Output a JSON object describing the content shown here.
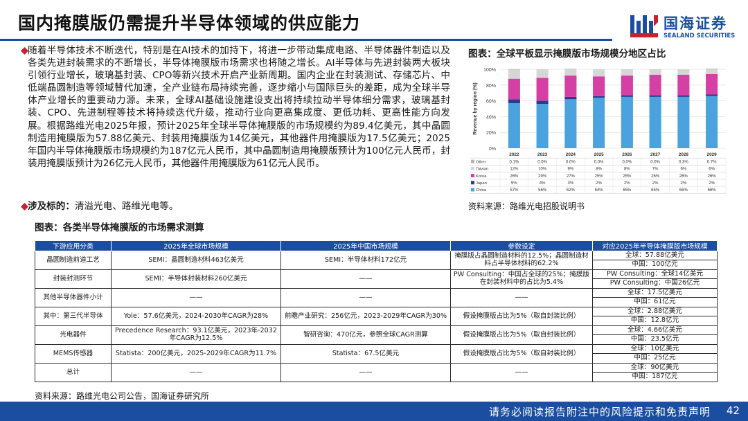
{
  "header": {
    "title": "国内掩膜版仍需提升半导体领域的供应能力",
    "brand_cn": "国海证券",
    "brand_en": "SEALAND SECURITIES"
  },
  "body": {
    "para1": "随着半导体技术不断迭代，特别是在AI技术的加持下，将进一步带动集成电路、半导体器件制造以及各类先进封装需求的不断增长，半导体掩膜版市场需求也将随之增长。AI半导体与先进封装两大板块引领行业增长，玻璃基封装、CPO等新兴技术开启产业新周期。国内企业在封装测试、存储芯片、中低端晶圆制造等领域替代加速，全产业链布局持续完善，逐步缩小与国际巨头的差距，成为全球半导体产业增长的重要动力源。未来，全球AI基础设施建设支出将持续拉动半导体细分需求，玻璃基封装、CPO、先进制程等技术将持续迭代升级，推动行业向更高集成度、更低功耗、更高性能方向发展。根据路维光电2025年报，预计2025年全球半导体掩膜版的市场规模约为89.4亿美元，其中晶圆制造用掩膜版为57.88亿美元、封装用掩膜版为14亿美元，其他器件用掩膜版为17.5亿美元；2025年国内半导体掩膜版市场规模约为187亿元人民币，其中晶圆制造用掩膜版预计为100亿元人民币，封装用掩膜版预计为26亿元人民币，其他器件用掩膜版为61亿元人民币。",
    "para2_label": "涉及标的：",
    "para2_text": "清溢光电、路维光电等。"
  },
  "chart": {
    "title": "图表：全球平板显示掩膜版市场规模分地区占比",
    "source": "资料来源：路维光电招股说明书"
  },
  "chart_data": {
    "type": "bar",
    "stacked": true,
    "categories": [
      "2022",
      "2023",
      "2024",
      "2025",
      "2026",
      "2027",
      "2028",
      "2029"
    ],
    "ylabel": "Revenue by region (%)",
    "yticks": [
      "0%",
      "20%",
      "40%",
      "60%",
      "80%",
      "100%"
    ],
    "ylim": [
      0,
      100
    ],
    "grid": true,
    "series": [
      {
        "name": "Other",
        "color": "#b3b3b3",
        "values": [
          0.1,
          0.0,
          0.0,
          0.0,
          0.0,
          0.0,
          0.3,
          0.7
        ],
        "labels": [
          "0.1%",
          "0.0%",
          "0.0%",
          "0.0%",
          "0.0%",
          "0.0%",
          "0.3%",
          "0.7%"
        ]
      },
      {
        "name": "Taiwan",
        "color": "#d6d6d6",
        "values": [
          12,
          10,
          9,
          8,
          8,
          7,
          6,
          6
        ],
        "labels": [
          "12%",
          "10%",
          "9%",
          "8%",
          "8%",
          "7%",
          "6%",
          "6%"
        ]
      },
      {
        "name": "Korea",
        "color": "#d63fa3",
        "values": [
          26,
          29,
          27,
          25,
          25,
          26,
          26,
          26
        ],
        "labels": [
          "26%",
          "29%",
          "27%",
          "25%",
          "25%",
          "26%",
          "26%",
          "26%"
        ]
      },
      {
        "name": "Japan",
        "color": "#2a3c8f",
        "values": [
          5,
          4,
          3,
          2,
          2,
          2,
          2,
          2
        ],
        "labels": [
          "5%",
          "4%",
          "3%",
          "2%",
          "2%",
          "2%",
          "2%",
          "2%"
        ]
      },
      {
        "name": "China",
        "color": "#4aa3df",
        "values": [
          57,
          56,
          62,
          64,
          65,
          65,
          65,
          66
        ],
        "labels": [
          "57%",
          "56%",
          "62%",
          "64%",
          "65%",
          "65%",
          "65%",
          "66%"
        ]
      }
    ]
  },
  "table": {
    "title": "图表：各类半导体掩膜版的市场需求测算",
    "headers": [
      "下游应用分类",
      "2025年全球市场规模",
      "2025年中国市场规模",
      "参数设定",
      "对应2025年半导体掩膜版市场规模"
    ],
    "rows": [
      {
        "cat": "晶圆制造前道工艺",
        "global": "SEMI：晶圆制造材料463亿美元",
        "china": "SEMI：半导体材料172亿元",
        "param": "掩膜版占晶圆制造材料的12.5%；晶圆制造材料占半导体材料的62.2%",
        "result": [
          "全球：57.88亿美元",
          "中国：100亿元"
        ]
      },
      {
        "cat": "封装封测环节",
        "global": "SEMI：半导体封装材料260亿美元",
        "china": "——",
        "param": "PW Consulting：中国占全球的25%；掩膜版在封装材料中的占比为5.4%",
        "result": [
          "PW Consulting：全球14亿美元",
          "PW Consulting：中国26亿元"
        ]
      },
      {
        "cat": "其他半导体器件小计",
        "global": "——",
        "china": "——",
        "param": "——",
        "result": [
          "全球：17.5亿美元",
          "中国：61亿元"
        ]
      },
      {
        "cat": "其中：第三代半导体",
        "global": "Yole：57.6亿美元，2024-2030年CAGR为28%",
        "china": "前瞻产业研究：256亿元，2023-2029年CAGR为30%",
        "param": "假设掩膜版占比为5%（取自封装比例）",
        "result": [
          "全球：2.88亿美元",
          "中国：12.8亿元"
        ]
      },
      {
        "cat": "光电器件",
        "global": "Precedence Research：93.1亿美元，2023年-2032年CAGR为12.5%",
        "china": "智研咨询：470亿元，参照全球CAGR测算",
        "param": "假设掩膜版占比为5%（取自封装比例）",
        "result": [
          "全球：4.66亿美元",
          "中国：23.5亿元"
        ]
      },
      {
        "cat": "MEMS传感器",
        "global": "Statista：200亿美元，2025-2029年CAGR为11.7%",
        "china": "Statista：67.5亿美元",
        "param": "假设掩膜版占比为5%（取自封装比例）",
        "result": [
          "全球：10亿美元",
          "中国：25亿元"
        ]
      },
      {
        "cat": "总计",
        "global": "——",
        "china": "——",
        "param": "——",
        "result": [
          "全球：90亿美元",
          "中国：187亿元"
        ]
      }
    ],
    "source": "资料来源：路维光电公司公告，国海证券研究所"
  },
  "footer": {
    "disclaimer": "请务必阅读报告附注中的风险提示和免责声明",
    "page": "42"
  }
}
